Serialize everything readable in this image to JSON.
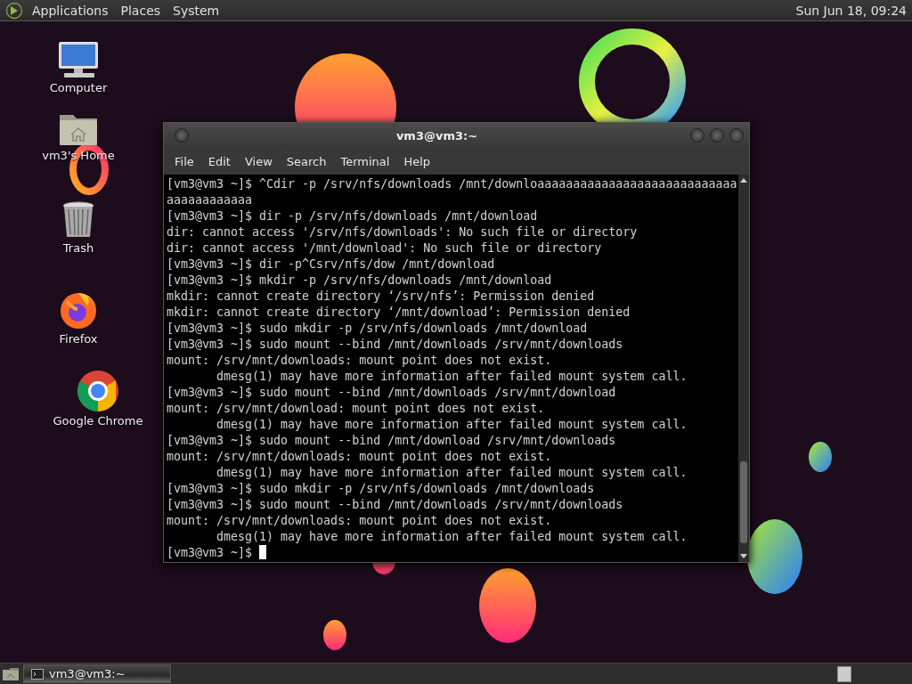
{
  "top_panel": {
    "menus": [
      "Applications",
      "Places",
      "System"
    ],
    "clock": "Sun Jun 18, 09:24"
  },
  "desktop_icons": [
    {
      "label": "Computer",
      "kind": "computer"
    },
    {
      "label": "vm3's Home",
      "kind": "home"
    },
    {
      "label": "Trash",
      "kind": "trash"
    },
    {
      "label": "Firefox",
      "kind": "firefox"
    },
    {
      "label": "Google Chrome",
      "kind": "chrome"
    }
  ],
  "window": {
    "title": "vm3@vm3:~",
    "menus": [
      "File",
      "Edit",
      "View",
      "Search",
      "Terminal",
      "Help"
    ],
    "lines": [
      "[vm3@vm3 ~]$ ^Cdir -p /srv/nfs/downloads /mnt/downloaaaaaaaaaaaaaaaaaaaaaaaaaaaaaaaaaaaaaaaa",
      "[vm3@vm3 ~]$ dir -p /srv/nfs/downloads /mnt/download",
      "dir: cannot access '/srv/nfs/downloads': No such file or directory",
      "dir: cannot access '/mnt/download': No such file or directory",
      "[vm3@vm3 ~]$ dir -p^Csrv/nfs/dow /mnt/download",
      "[vm3@vm3 ~]$ mkdir -p /srv/nfs/downloads /mnt/download",
      "mkdir: cannot create directory ‘/srv/nfs’: Permission denied",
      "mkdir: cannot create directory ‘/mnt/download’: Permission denied",
      "[vm3@vm3 ~]$ sudo mkdir -p /srv/nfs/downloads /mnt/download",
      "[vm3@vm3 ~]$ sudo mount --bind /mnt/downloads /srv/mnt/downloads",
      "mount: /srv/mnt/downloads: mount point does not exist.",
      "       dmesg(1) may have more information after failed mount system call.",
      "[vm3@vm3 ~]$ sudo mount --bind /mnt/downloads /srv/mnt/download",
      "mount: /srv/mnt/download: mount point does not exist.",
      "       dmesg(1) may have more information after failed mount system call.",
      "[vm3@vm3 ~]$ sudo mount --bind /mnt/download /srv/mnt/downloads",
      "mount: /srv/mnt/downloads: mount point does not exist.",
      "       dmesg(1) may have more information after failed mount system call.",
      "[vm3@vm3 ~]$ sudo mkdir -p /srv/nfs/downloads /mnt/downloads",
      "[vm3@vm3 ~]$ sudo mount --bind /mnt/downloads /srv/mnt/downloads",
      "mount: /srv/mnt/downloads: mount point does not exist.",
      "       dmesg(1) may have more information after failed mount system call.",
      "[vm3@vm3 ~]$"
    ]
  },
  "bottom_panel": {
    "tasks": [
      {
        "label": "vm3@vm3:~",
        "selected": true
      }
    ]
  }
}
